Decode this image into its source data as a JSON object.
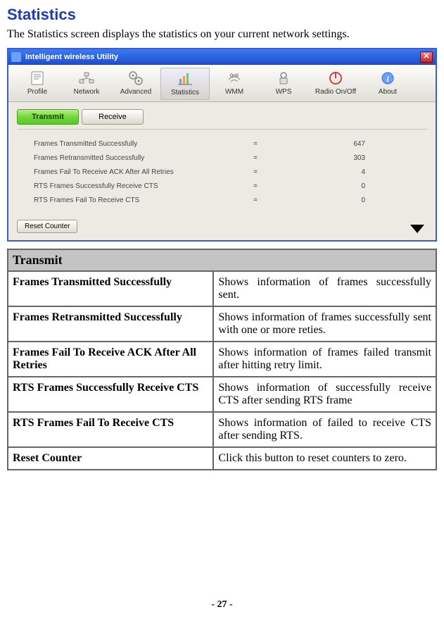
{
  "section_title": "Statistics",
  "intro": "The Statistics screen displays the statistics on your current network settings.",
  "window": {
    "title": "Intelligent wireless Utility",
    "toolbar": [
      {
        "label": "Profile"
      },
      {
        "label": "Network"
      },
      {
        "label": "Advanced"
      },
      {
        "label": "Statistics"
      },
      {
        "label": "WMM"
      },
      {
        "label": "WPS"
      },
      {
        "label": "Radio On/Off"
      },
      {
        "label": "About"
      }
    ],
    "tabs": {
      "transmit": "Transmit",
      "receive": "Receive"
    },
    "stats": [
      {
        "label": "Frames Transmitted Successfully",
        "value": "647"
      },
      {
        "label": "Frames Retransmitted Successfully",
        "value": "303"
      },
      {
        "label": "Frames Fail To Receive ACK After All Retries",
        "value": "4"
      },
      {
        "label": "RTS Frames Successfully Receive CTS",
        "value": "0"
      },
      {
        "label": "RTS Frames Fail To Receive CTS",
        "value": "0"
      }
    ],
    "reset_button": "Reset Counter"
  },
  "table": {
    "header": "Transmit",
    "rows": [
      {
        "name": "Frames Transmitted Successfully",
        "desc": "Shows information of frames successfully sent."
      },
      {
        "name": "Frames Retransmitted Successfully",
        "desc": "Shows information of frames successfully sent with one or more reties."
      },
      {
        "name": "Frames Fail To Receive ACK After All Retries",
        "desc": "Shows information of frames failed transmit after hitting retry limit."
      },
      {
        "name": "RTS Frames Successfully Receive CTS",
        "desc": "Shows information of successfully receive CTS after sending RTS frame"
      },
      {
        "name": "RTS Frames Fail To Receive CTS",
        "desc": "Shows information of failed to receive CTS after sending RTS."
      },
      {
        "name": "Reset Counter",
        "desc": "Click this button to reset counters to zero."
      }
    ]
  },
  "page_number": "- 27 -"
}
